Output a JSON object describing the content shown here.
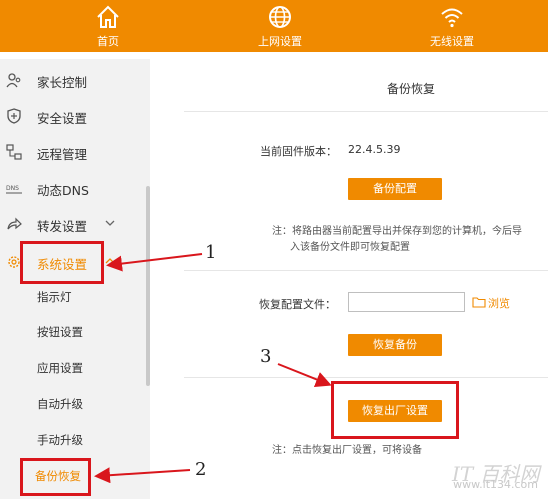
{
  "topnav": [
    {
      "label": "首页",
      "icon": "home-icon"
    },
    {
      "label": "上网设置",
      "icon": "globe-icon"
    },
    {
      "label": "无线设置",
      "icon": "wifi-icon"
    }
  ],
  "sidebar": {
    "items": [
      {
        "label": "家长控制",
        "icon": "parent-icon"
      },
      {
        "label": "安全设置",
        "icon": "shield-icon"
      },
      {
        "label": "远程管理",
        "icon": "remote-icon"
      },
      {
        "label": "动态DNS",
        "icon": "dns-icon"
      },
      {
        "label": "转发设置",
        "icon": "forward-icon"
      },
      {
        "label": "系统设置",
        "icon": "gear-icon"
      }
    ],
    "subitems": [
      "指示灯",
      "按钮设置",
      "应用设置",
      "自动升级",
      "手动升级",
      "备份恢复"
    ]
  },
  "panel": {
    "title": "备份恢复",
    "firmware_label": "当前固件版本：",
    "firmware_value": "22.4.5.39",
    "backup_button": "备份配置",
    "backup_note_line1": "注：将路由器当前配置导出并保存到您的计算机，今后导",
    "backup_note_line2": "入该备份文件即可恢复配置",
    "restore_file_label": "恢复配置文件：",
    "restore_file_value": "",
    "browse_label": "浏览",
    "restore_button": "恢复备份",
    "factory_button": "恢复出厂设置",
    "factory_note": "注：点击恢复出厂设置，可将设备"
  },
  "annotations": {
    "step1": "1",
    "step2": "2",
    "step3": "3"
  },
  "watermark": {
    "brand": "IT 百科网",
    "url": "www.it134.com"
  },
  "colors": {
    "accent": "#f08a00",
    "annotation": "#d9161c",
    "sidebar_bg": "#f2f2f2"
  }
}
